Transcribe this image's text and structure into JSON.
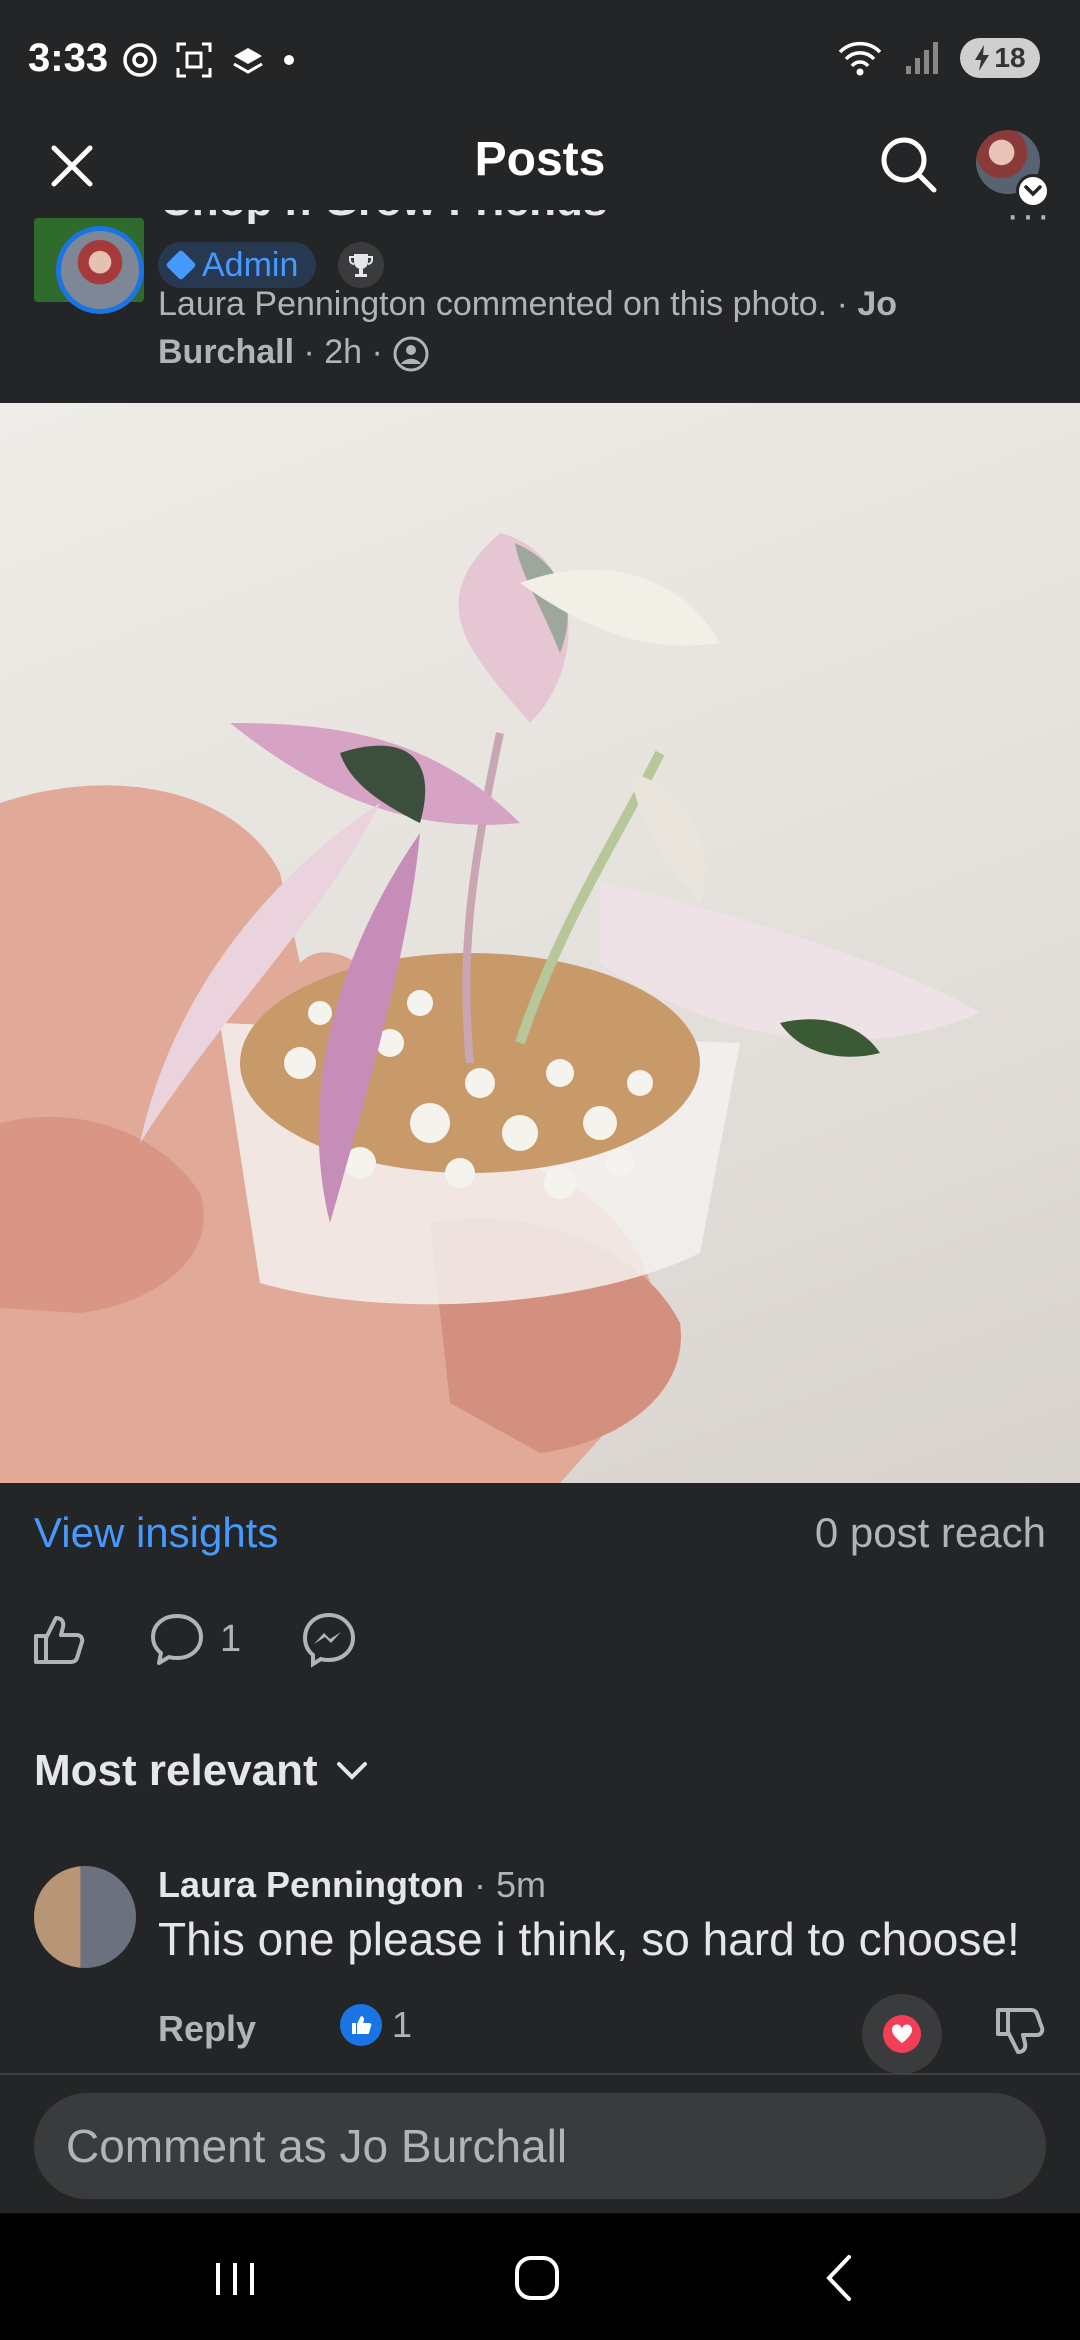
{
  "status_bar": {
    "time": "3:33",
    "battery": "18"
  },
  "app_bar": {
    "title": "Posts"
  },
  "post": {
    "group_name": "Chop n Grow Friends",
    "admin_label": "Admin",
    "meta_commenter": "Laura Pennington commented on this photo.",
    "meta_author": "Jo Burchall",
    "meta_time": "2h"
  },
  "insights": {
    "view_insights": "View insights",
    "post_reach": "0 post reach"
  },
  "actions": {
    "comment_count": "1"
  },
  "comments_section": {
    "sort_label": "Most relevant",
    "comments": [
      {
        "author": "Laura Pennington",
        "time": "· 5m",
        "text": "This one please i think, so hard to choose!",
        "reply_label": "Reply",
        "like_count": "1"
      }
    ]
  },
  "composer": {
    "placeholder": "Comment as Jo Burchall"
  },
  "colors": {
    "background": "#242526",
    "accent_blue": "#4599ff",
    "heart_red": "#f33e58"
  }
}
